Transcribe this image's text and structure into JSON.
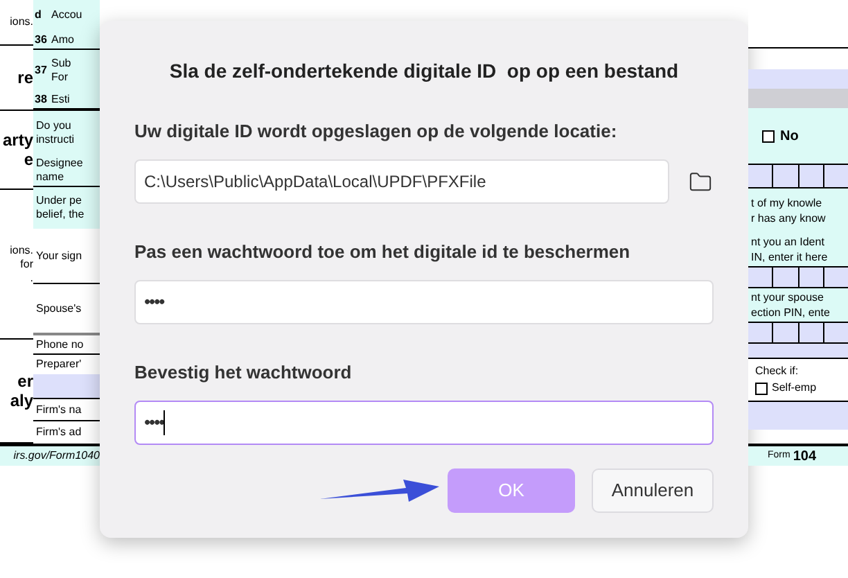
{
  "form_left": {
    "side_texts": [
      {
        "kind": "note",
        "lines": [
          "ions."
        ]
      },
      {
        "kind": "heading",
        "lines": [
          "re"
        ]
      },
      {
        "kind": "heading",
        "lines": [
          "arty",
          "e"
        ]
      },
      {
        "kind": "note",
        "lines": [
          "ions.",
          "for",
          "."
        ]
      },
      {
        "kind": "heading",
        "lines": [
          "er",
          "aly"
        ]
      }
    ],
    "rows": [
      {
        "number": "d",
        "lines": [
          "Accou"
        ],
        "color": "#dcfaf6"
      },
      {
        "number": "36",
        "lines": [
          "Amo"
        ],
        "color": "#dcfaf6"
      },
      {
        "number": "37",
        "lines": [
          "Sub",
          "For"
        ],
        "color": "#dcfaf6"
      },
      {
        "number": "38",
        "lines": [
          "Esti"
        ],
        "color": "#dcfaf6"
      },
      {
        "lines": [
          "Do you",
          "instructi"
        ],
        "color": "#dcfaf6"
      },
      {
        "lines": [
          "Designee",
          "name"
        ],
        "color": "#dcfaf6"
      },
      {
        "lines": [
          "Under pe",
          "belief, the"
        ],
        "color": "#dcfaf6"
      },
      {
        "lines": [
          "Your sign"
        ],
        "color": "#ffffff"
      },
      {
        "lines": [
          "Spouse's"
        ],
        "color": "#ffffff"
      },
      {
        "lines": [
          "Phone no"
        ],
        "color": "#ffffff"
      },
      {
        "lines": [
          "Preparer'"
        ],
        "color": "#ffffff"
      },
      {
        "color": "#dde0fb"
      },
      {
        "lines": [
          "Firm's na"
        ],
        "color": "#ffffff"
      },
      {
        "lines": [
          "Firm's ad"
        ],
        "color": "#ffffff"
      }
    ],
    "footer_link": "irs.gov/Form1040"
  },
  "dialog": {
    "title": "Sla de zelf-ondertekende digitale ID  op op een bestand",
    "fields": [
      {
        "kind": "path",
        "label": "Uw digitale ID wordt opgeslagen op de volgende locatie:",
        "value": "C:\\Users\\Public\\AppData\\Local\\UPDF\\PFXFile",
        "focused": false
      },
      {
        "kind": "password",
        "label": "Pas een wachtwoord toe om het digitale id te beschermen",
        "value": "••••",
        "focused": false
      },
      {
        "kind": "password",
        "label": "Bevestig het wachtwoord",
        "value": "••••",
        "focused": true
      }
    ],
    "buttons": [
      {
        "kind": "primary",
        "label": "OK",
        "disabled": true
      },
      {
        "kind": "secondary",
        "label": "Annuleren",
        "disabled": false
      }
    ]
  },
  "form_right": {
    "blocks": [
      {
        "kind": "blank",
        "color": "#ffffff"
      },
      {
        "kind": "blank",
        "color": "#dde0fb"
      },
      {
        "kind": "blank",
        "color": "#cfcfd4"
      },
      {
        "kind": "checkbox",
        "label": "No",
        "checked": false,
        "color": "#dcfaf6"
      },
      {
        "kind": "boxes",
        "color": "#dde0fb"
      },
      {
        "kind": "text",
        "lines": [
          "t of my knowle",
          "r has any know"
        ],
        "color": "#dcfaf6"
      },
      {
        "kind": "text",
        "lines": [
          "nt you an Ident",
          "IN, enter it here"
        ],
        "color": "#dcfaf6"
      },
      {
        "kind": "boxes",
        "color": "#dde0fb"
      },
      {
        "kind": "text",
        "lines": [
          "nt your spouse",
          "ection PIN, ente"
        ],
        "color": "#dcfaf6"
      },
      {
        "kind": "boxes",
        "color": "#dde0fb"
      },
      {
        "kind": "blank",
        "color": "#dde0fb"
      },
      {
        "kind": "check_group",
        "title": "Check if:",
        "label": "Self-emp",
        "checked": false,
        "color": "#ffffff"
      },
      {
        "kind": "blank",
        "color": "#dde0fb"
      }
    ],
    "footer": {
      "prefix": "Form",
      "number": "104"
    }
  }
}
